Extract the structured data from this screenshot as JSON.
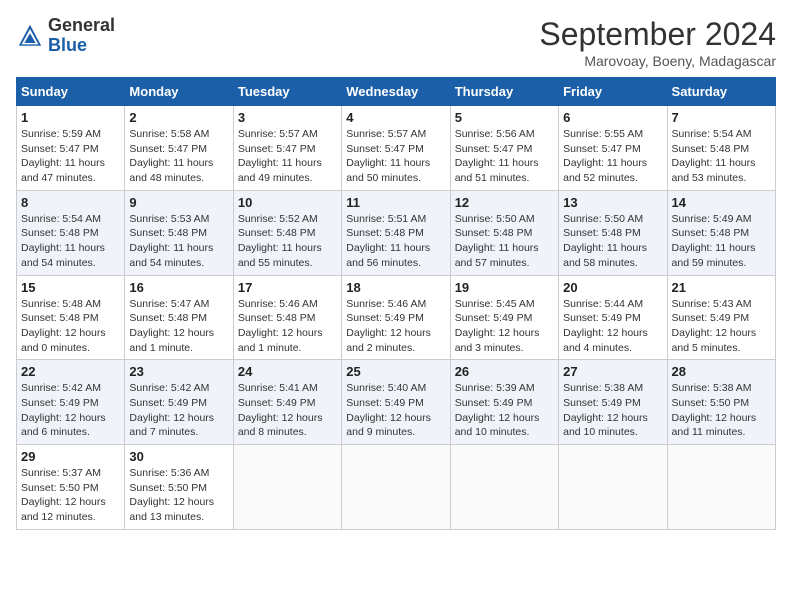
{
  "header": {
    "logo_general": "General",
    "logo_blue": "Blue",
    "month_title": "September 2024",
    "location": "Marovoay, Boeny, Madagascar"
  },
  "weekdays": [
    "Sunday",
    "Monday",
    "Tuesday",
    "Wednesday",
    "Thursday",
    "Friday",
    "Saturday"
  ],
  "weeks": [
    [
      {
        "day": "1",
        "sunrise": "5:59 AM",
        "sunset": "5:47 PM",
        "daylight": "11 hours and 47 minutes."
      },
      {
        "day": "2",
        "sunrise": "5:58 AM",
        "sunset": "5:47 PM",
        "daylight": "11 hours and 48 minutes."
      },
      {
        "day": "3",
        "sunrise": "5:57 AM",
        "sunset": "5:47 PM",
        "daylight": "11 hours and 49 minutes."
      },
      {
        "day": "4",
        "sunrise": "5:57 AM",
        "sunset": "5:47 PM",
        "daylight": "11 hours and 50 minutes."
      },
      {
        "day": "5",
        "sunrise": "5:56 AM",
        "sunset": "5:47 PM",
        "daylight": "11 hours and 51 minutes."
      },
      {
        "day": "6",
        "sunrise": "5:55 AM",
        "sunset": "5:47 PM",
        "daylight": "11 hours and 52 minutes."
      },
      {
        "day": "7",
        "sunrise": "5:54 AM",
        "sunset": "5:48 PM",
        "daylight": "11 hours and 53 minutes."
      }
    ],
    [
      {
        "day": "8",
        "sunrise": "5:54 AM",
        "sunset": "5:48 PM",
        "daylight": "11 hours and 54 minutes."
      },
      {
        "day": "9",
        "sunrise": "5:53 AM",
        "sunset": "5:48 PM",
        "daylight": "11 hours and 54 minutes."
      },
      {
        "day": "10",
        "sunrise": "5:52 AM",
        "sunset": "5:48 PM",
        "daylight": "11 hours and 55 minutes."
      },
      {
        "day": "11",
        "sunrise": "5:51 AM",
        "sunset": "5:48 PM",
        "daylight": "11 hours and 56 minutes."
      },
      {
        "day": "12",
        "sunrise": "5:50 AM",
        "sunset": "5:48 PM",
        "daylight": "11 hours and 57 minutes."
      },
      {
        "day": "13",
        "sunrise": "5:50 AM",
        "sunset": "5:48 PM",
        "daylight": "11 hours and 58 minutes."
      },
      {
        "day": "14",
        "sunrise": "5:49 AM",
        "sunset": "5:48 PM",
        "daylight": "11 hours and 59 minutes."
      }
    ],
    [
      {
        "day": "15",
        "sunrise": "5:48 AM",
        "sunset": "5:48 PM",
        "daylight": "12 hours and 0 minutes."
      },
      {
        "day": "16",
        "sunrise": "5:47 AM",
        "sunset": "5:48 PM",
        "daylight": "12 hours and 1 minute."
      },
      {
        "day": "17",
        "sunrise": "5:46 AM",
        "sunset": "5:48 PM",
        "daylight": "12 hours and 1 minute."
      },
      {
        "day": "18",
        "sunrise": "5:46 AM",
        "sunset": "5:49 PM",
        "daylight": "12 hours and 2 minutes."
      },
      {
        "day": "19",
        "sunrise": "5:45 AM",
        "sunset": "5:49 PM",
        "daylight": "12 hours and 3 minutes."
      },
      {
        "day": "20",
        "sunrise": "5:44 AM",
        "sunset": "5:49 PM",
        "daylight": "12 hours and 4 minutes."
      },
      {
        "day": "21",
        "sunrise": "5:43 AM",
        "sunset": "5:49 PM",
        "daylight": "12 hours and 5 minutes."
      }
    ],
    [
      {
        "day": "22",
        "sunrise": "5:42 AM",
        "sunset": "5:49 PM",
        "daylight": "12 hours and 6 minutes."
      },
      {
        "day": "23",
        "sunrise": "5:42 AM",
        "sunset": "5:49 PM",
        "daylight": "12 hours and 7 minutes."
      },
      {
        "day": "24",
        "sunrise": "5:41 AM",
        "sunset": "5:49 PM",
        "daylight": "12 hours and 8 minutes."
      },
      {
        "day": "25",
        "sunrise": "5:40 AM",
        "sunset": "5:49 PM",
        "daylight": "12 hours and 9 minutes."
      },
      {
        "day": "26",
        "sunrise": "5:39 AM",
        "sunset": "5:49 PM",
        "daylight": "12 hours and 10 minutes."
      },
      {
        "day": "27",
        "sunrise": "5:38 AM",
        "sunset": "5:49 PM",
        "daylight": "12 hours and 10 minutes."
      },
      {
        "day": "28",
        "sunrise": "5:38 AM",
        "sunset": "5:50 PM",
        "daylight": "12 hours and 11 minutes."
      }
    ],
    [
      {
        "day": "29",
        "sunrise": "5:37 AM",
        "sunset": "5:50 PM",
        "daylight": "12 hours and 12 minutes."
      },
      {
        "day": "30",
        "sunrise": "5:36 AM",
        "sunset": "5:50 PM",
        "daylight": "12 hours and 13 minutes."
      },
      null,
      null,
      null,
      null,
      null
    ]
  ]
}
